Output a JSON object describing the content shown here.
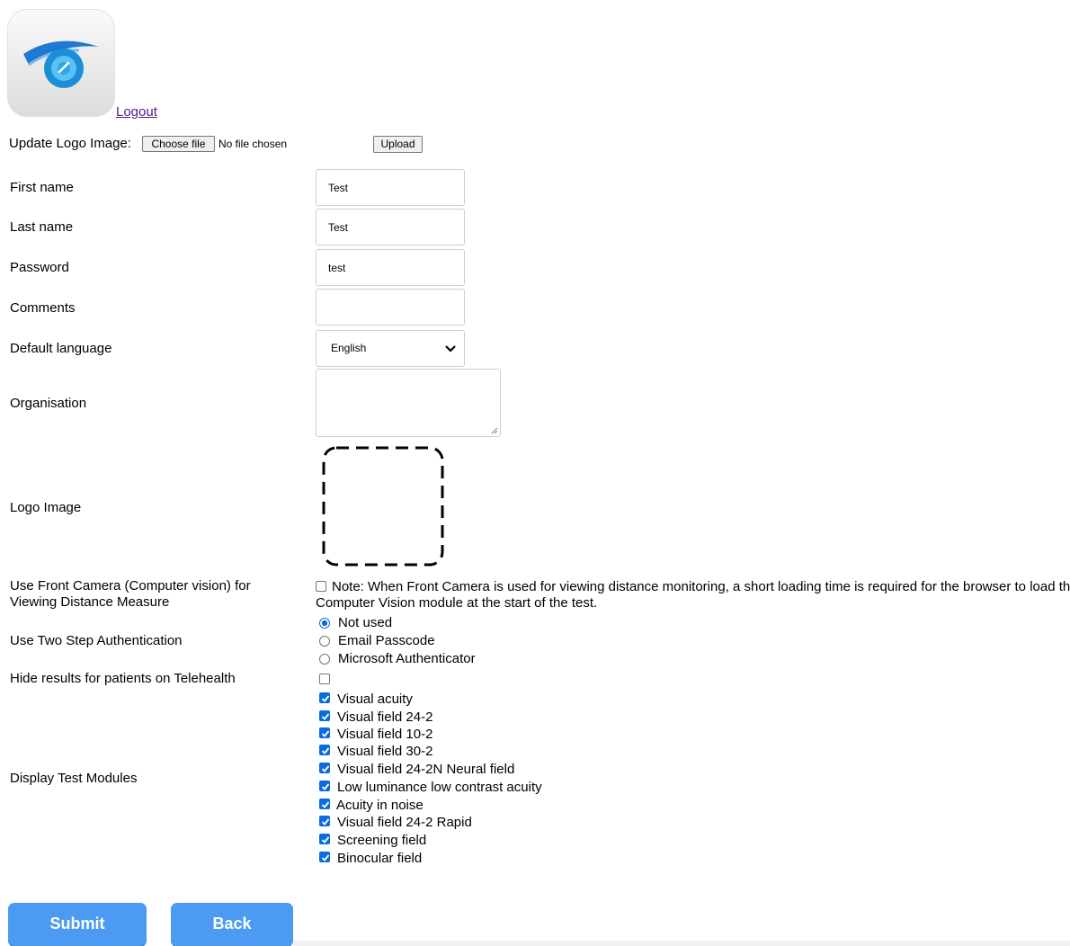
{
  "header": {
    "logout_label": "Logout"
  },
  "upload": {
    "label": "Update Logo Image:",
    "choose_label": "Choose file",
    "status": "No file chosen",
    "upload_label": "Upload"
  },
  "form": {
    "first_name": {
      "label": "First name",
      "value": "Test"
    },
    "last_name": {
      "label": "Last name",
      "value": "Test"
    },
    "password": {
      "label": "Password",
      "value": "test"
    },
    "comments": {
      "label": "Comments",
      "value": ""
    },
    "default_language": {
      "label": "Default language",
      "selected": "English"
    },
    "organisation": {
      "label": "Organisation",
      "value": ""
    },
    "logo_image": {
      "label": "Logo Image"
    },
    "front_camera": {
      "label": "Use Front Camera (Computer vision) for Viewing Distance Measure",
      "checked": false,
      "note": "Note: When Front Camera is used for viewing distance monitoring, a short loading time is required for the browser to load the Computer Vision module at the start of the test."
    },
    "two_step": {
      "label": "Use Two Step Authentication",
      "options": [
        {
          "label": "Not used",
          "selected": true
        },
        {
          "label": "Email Passcode",
          "selected": false
        },
        {
          "label": "Microsoft Authenticator",
          "selected": false
        }
      ]
    },
    "hide_results": {
      "label": "Hide results for patients on Telehealth",
      "checked": false
    },
    "test_modules": {
      "label": "Display Test Modules",
      "items": [
        {
          "label": "Visual acuity",
          "checked": true
        },
        {
          "label": "Visual field 24-2",
          "checked": true
        },
        {
          "label": "Visual field 10-2",
          "checked": true
        },
        {
          "label": "Visual field 30-2",
          "checked": true
        },
        {
          "label": "Visual field 24-2N Neural field",
          "checked": true
        },
        {
          "label": "Low luminance low contrast acuity",
          "checked": true
        },
        {
          "label": "Acuity in noise",
          "checked": true
        },
        {
          "label": "Visual field 24-2 Rapid",
          "checked": true
        },
        {
          "label": "Screening field",
          "checked": true
        },
        {
          "label": "Binocular field",
          "checked": true
        }
      ]
    }
  },
  "actions": {
    "submit_label": "Submit",
    "back_label": "Back"
  },
  "colors": {
    "accent": "#4a9bf1",
    "checkbox_blue": "#0b6bdf",
    "link": "#551a8b"
  },
  "icons": {
    "app_logo": "eye-logo-icon",
    "select": "chevron-down-icon"
  }
}
